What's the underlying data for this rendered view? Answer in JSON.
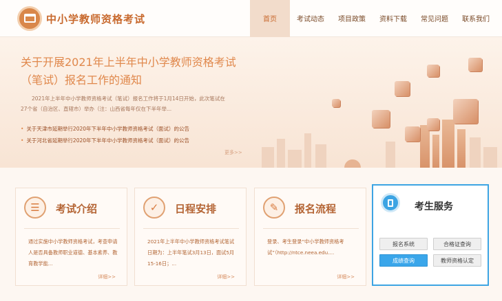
{
  "header": {
    "site_title": "中小学教师资格考试",
    "nav": [
      {
        "label": "首页",
        "active": true
      },
      {
        "label": "考试动态",
        "active": false
      },
      {
        "label": "项目政策",
        "active": false
      },
      {
        "label": "资料下载",
        "active": false
      },
      {
        "label": "常见问题",
        "active": false
      },
      {
        "label": "联系我们",
        "active": false
      }
    ]
  },
  "banner": {
    "headline": "关于开展2021年上半年中小学教师资格考试（笔试）报名工作的通知",
    "summary": "2021年上半年中小学教师资格考试（笔试）报名工作将于1月14日开始，此次笔试在27个省（自治区、直辖市）举办（注：山西省每年仅在下半年举...",
    "news": [
      "关于天津市延期举行2020年下半年中小学教师资格考试（面试）的公告",
      "关于河北省延期举行2020年下半年中小学教师资格考试（面试）的公告"
    ],
    "more": "更多>>"
  },
  "cards": [
    {
      "icon": "document-icon",
      "title": "考试介绍",
      "text": "通过实施中小学教师资格考试，考查申请人是否具备教师职业道德、基本素养、教育教学能...",
      "more": "详细>>"
    },
    {
      "icon": "checkmark-icon",
      "title": "日程安排",
      "text": "2021年上半年中小学教师资格考试笔试日期为：上半年笔试3月13日，面试5月15-16日；...",
      "more": "详细>>"
    },
    {
      "icon": "form-icon",
      "title": "报名流程",
      "text": "登录、考生登录“中小学教师资格考试”（http://ntce.neea.edu....",
      "more": "详细>>"
    }
  ],
  "service": {
    "title": "考生服务",
    "buttons": [
      {
        "label": "报名系统",
        "primary": false
      },
      {
        "label": "合格证查询",
        "primary": false
      },
      {
        "label": "成绩查询",
        "primary": true
      },
      {
        "label": "教师资格认定",
        "primary": false
      }
    ],
    "accent": "#3ca4e3"
  }
}
